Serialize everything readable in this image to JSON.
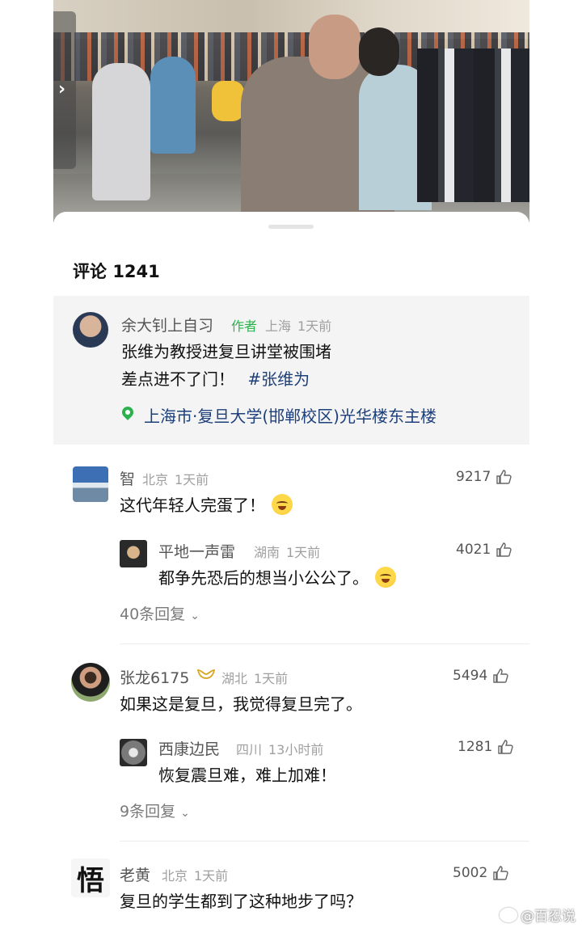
{
  "comments_header": {
    "label": "评论",
    "count": "1241"
  },
  "post": {
    "author": "余大钊上自习",
    "author_tag": "作者",
    "region": "上海",
    "time": "1天前",
    "line1": "张维为教授进复旦讲堂被围堵",
    "line2": "差点进不了门！",
    "hashtag": "#张维为",
    "location": "上海市·复旦大学(邯郸校区)光华楼东主楼"
  },
  "comments": [
    {
      "user": "智",
      "region": "北京",
      "time": "1天前",
      "likes": "9217",
      "text": "这代年轻人完蛋了！",
      "emoji": "laugh-cry-emoji",
      "reply": {
        "user": "平地一声雷",
        "region": "湖南",
        "time": "1天前",
        "likes": "4021",
        "text": "都争先恐后的想当小公公了。",
        "emoji": "laugh-cry-emoji"
      },
      "more_replies": "40条回复"
    },
    {
      "user": "张龙6175",
      "region": "湖北",
      "time": "1天前",
      "likes": "5494",
      "text": "如果这是复旦，我觉得复旦完了。",
      "reply": {
        "user": "西康边民",
        "region": "四川",
        "time": "13小时前",
        "likes": "1281",
        "text": "恢复震旦难，难上加难！"
      },
      "more_replies": "9条回复"
    },
    {
      "user": "老黄",
      "region": "北京",
      "time": "1天前",
      "likes": "5002",
      "text": "复旦的学生都到了这种地步了吗？",
      "avatar_char": "悟"
    }
  ],
  "watermark": "@百忍说",
  "colors": {
    "green": "#2bb24c",
    "link": "#1d3f7a",
    "gold": "#d9a520"
  }
}
